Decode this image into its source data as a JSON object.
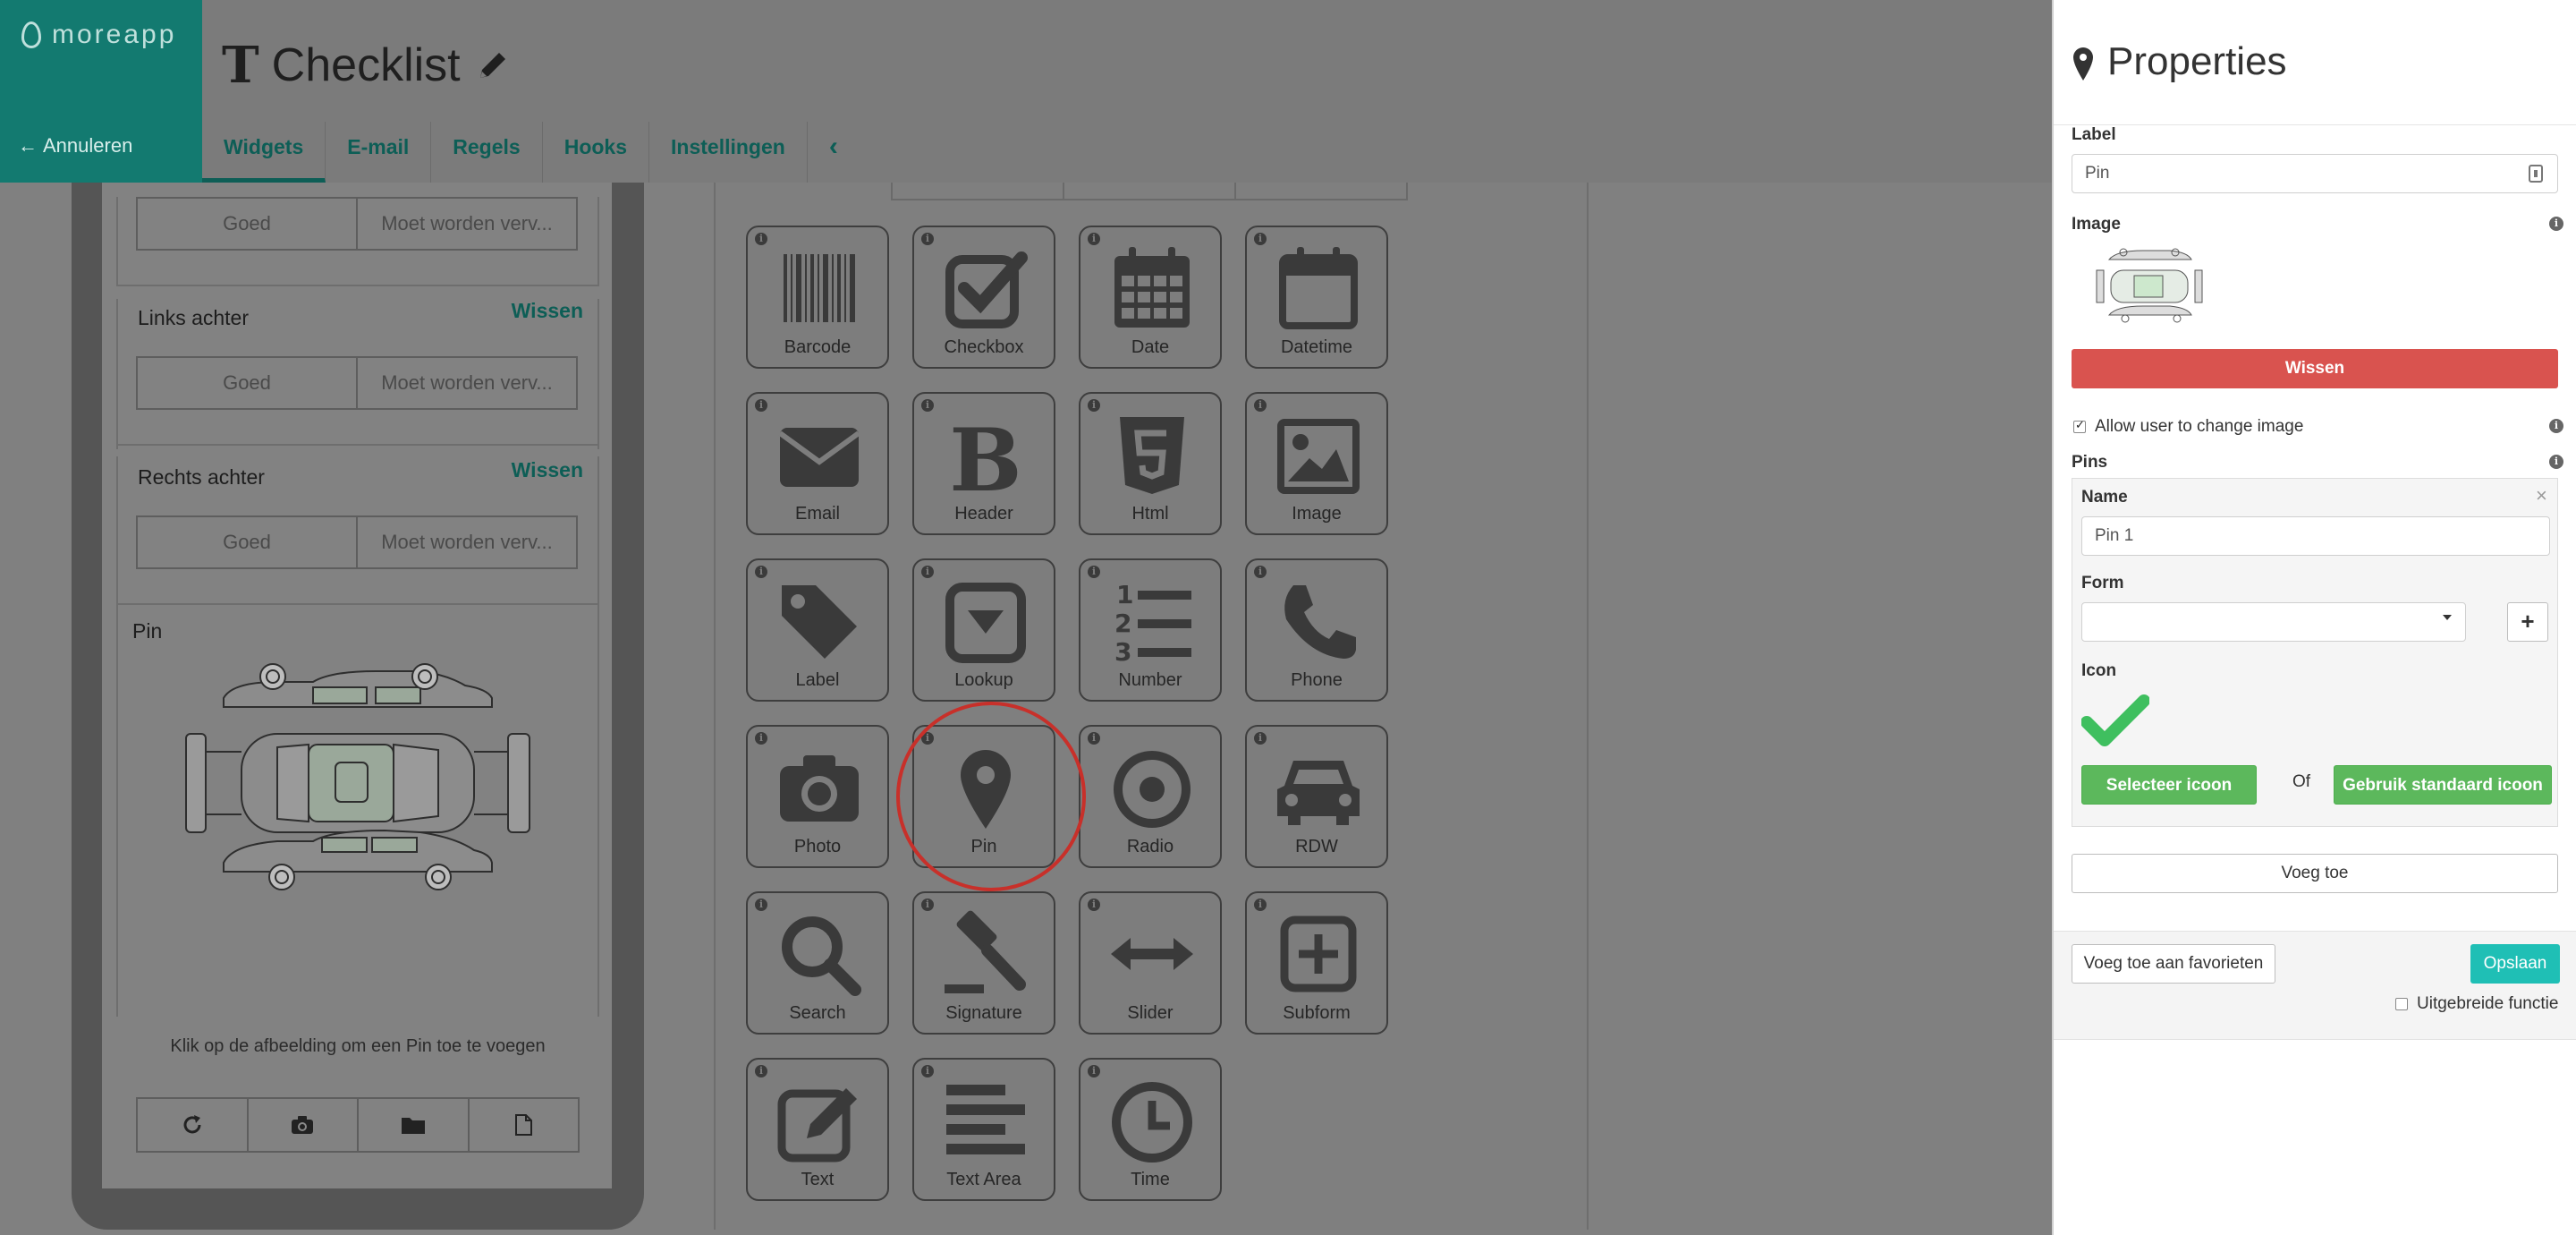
{
  "header": {
    "logo_text": "moreapp",
    "cancel_label": "Annuleren",
    "title": "Checklist",
    "tabs": [
      {
        "label": "Widgets"
      },
      {
        "label": "E-mail"
      },
      {
        "label": "Regels"
      },
      {
        "label": "Hooks"
      },
      {
        "label": "Instellingen"
      }
    ],
    "collapse_glyph": "‹"
  },
  "preview": {
    "seg_left": "Goed",
    "seg_right": "Moet worden verv...",
    "sections": [
      {
        "label": "Links achter",
        "clear": "Wissen"
      },
      {
        "label": "Rechts achter",
        "clear": "Wissen"
      }
    ],
    "pin_label": "Pin",
    "pin_help": "Klik op de afbeelding om een Pin toe te voegen",
    "tool_icons": [
      "refresh-icon",
      "camera-icon",
      "folder-icon",
      "file-icon"
    ]
  },
  "palette": {
    "widgets": [
      {
        "label": "Barcode",
        "icon": "barcode-icon"
      },
      {
        "label": "Checkbox",
        "icon": "checkbox-icon"
      },
      {
        "label": "Date",
        "icon": "calendar-icon"
      },
      {
        "label": "Datetime",
        "icon": "calendar-empty-icon"
      },
      {
        "label": "Email",
        "icon": "envelope-icon"
      },
      {
        "label": "Header",
        "icon": "bold-b-icon"
      },
      {
        "label": "Html",
        "icon": "html5-icon"
      },
      {
        "label": "Image",
        "icon": "picture-icon"
      },
      {
        "label": "Label",
        "icon": "tag-icon"
      },
      {
        "label": "Lookup",
        "icon": "dropdown-box-icon"
      },
      {
        "label": "Number",
        "icon": "numbered-list-icon"
      },
      {
        "label": "Phone",
        "icon": "phone-icon"
      },
      {
        "label": "Photo",
        "icon": "camera-icon"
      },
      {
        "label": "Pin",
        "icon": "map-marker-icon"
      },
      {
        "label": "Radio",
        "icon": "radio-dot-icon"
      },
      {
        "label": "RDW",
        "icon": "car-icon"
      },
      {
        "label": "Search",
        "icon": "magnifier-icon"
      },
      {
        "label": "Signature",
        "icon": "gavel-icon"
      },
      {
        "label": "Slider",
        "icon": "arrows-horizontal-icon"
      },
      {
        "label": "Subform",
        "icon": "plus-square-icon"
      },
      {
        "label": "Text",
        "icon": "edit-icon"
      },
      {
        "label": "Text Area",
        "icon": "align-left-icon"
      },
      {
        "label": "Time",
        "icon": "clock-icon"
      }
    ],
    "highlighted": "Pin"
  },
  "properties": {
    "title": "Properties",
    "label_caption": "Label",
    "label_value": "Pin",
    "image_caption": "Image",
    "clear_image": "Wissen",
    "allow_change": "Allow user to change image",
    "allow_change_checked": true,
    "pins_caption": "Pins",
    "pin_name_caption": "Name",
    "pin_name_value": "Pin 1",
    "form_caption": "Form",
    "form_value": "",
    "icon_caption": "Icon",
    "select_icon": "Selecteer icoon",
    "or_text": "Of",
    "default_icon": "Gebruik standaard icoon",
    "add": "Voeg toe",
    "add_favorites": "Voeg toe aan favorieten",
    "save": "Opslaan",
    "advanced": "Uitgebreide functie",
    "advanced_checked": false,
    "colors": {
      "danger": "#d9534f",
      "success": "#5cb85c",
      "primary": "#1fbfb5",
      "check": "#3fbf5f"
    }
  }
}
